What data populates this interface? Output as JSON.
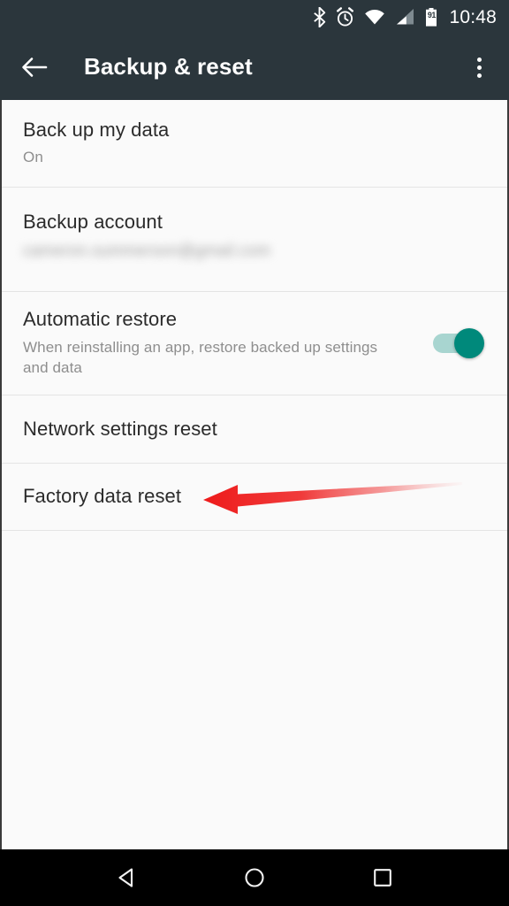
{
  "status_bar": {
    "clock": "10:48",
    "battery_percent": "91",
    "icons": [
      "bluetooth-icon",
      "alarm-icon",
      "wifi-icon",
      "cellular-signal-icon",
      "battery-icon"
    ],
    "background_color": "#2b363c"
  },
  "app_bar": {
    "title": "Backup & reset",
    "back_icon": "arrow-left-icon",
    "overflow_icon": "more-vertical-icon",
    "background_color": "#2b363c",
    "title_color": "#ffffff"
  },
  "settings_list": {
    "rows": [
      {
        "title": "Back up my data",
        "subtitle": "On",
        "name": "back-up-my-data"
      },
      {
        "title": "Backup account",
        "subtitle": "cameron.summerson@gmail.com",
        "name": "backup-account",
        "redacted": true
      },
      {
        "title": "Automatic restore",
        "subtitle": "When reinstalling an app, restore backed up settings and data",
        "name": "automatic-restore",
        "switch_on": true,
        "switch_track_color": "#a8d5d0",
        "switch_thumb_color": "#00897b"
      },
      {
        "title": "Network settings reset",
        "subtitle": "",
        "name": "network-settings-reset"
      },
      {
        "title": "Factory data reset",
        "subtitle": "",
        "name": "factory-data-reset"
      }
    ]
  },
  "annotation": {
    "type": "arrow",
    "points_to": "Factory data reset",
    "direction": "left",
    "color": "#ee1b1b"
  },
  "nav_bar": {
    "back_label": "back-triangle-icon",
    "home_label": "home-circle-icon",
    "recents_label": "recents-square-icon",
    "background_color": "#000000"
  }
}
